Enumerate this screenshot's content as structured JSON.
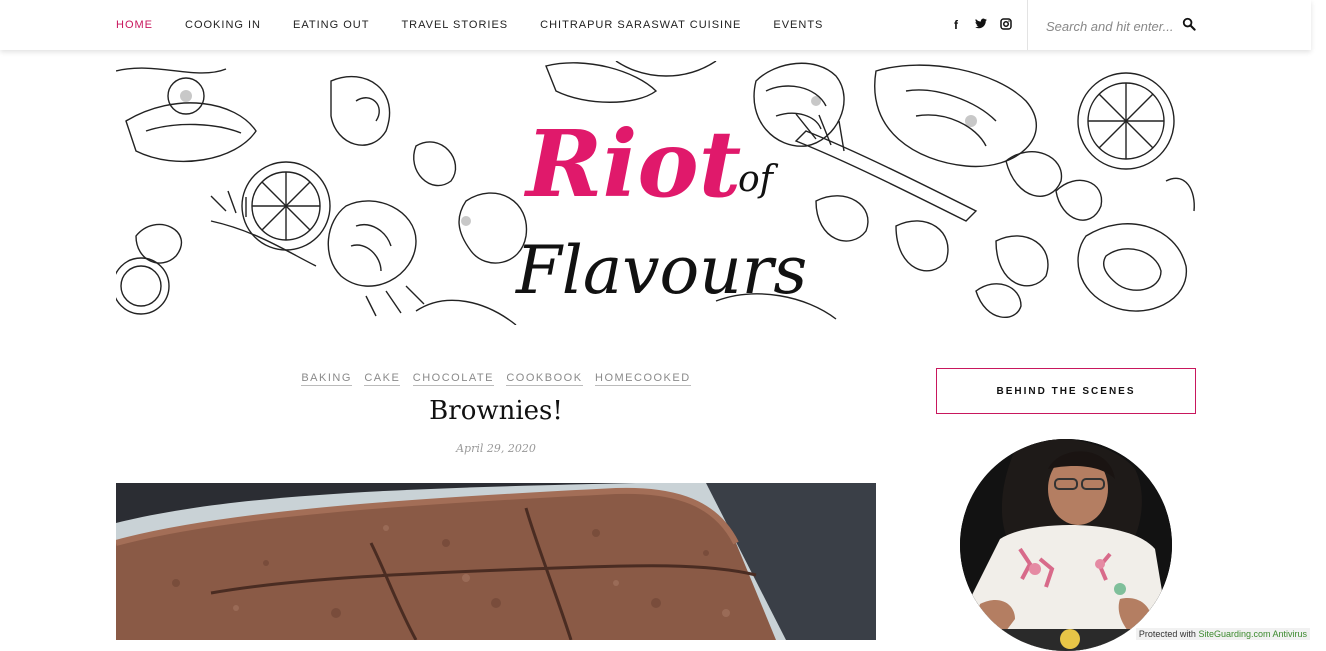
{
  "nav": {
    "items": [
      {
        "label": "HOME",
        "active": true
      },
      {
        "label": "COOKING IN",
        "active": false
      },
      {
        "label": "EATING OUT",
        "active": false
      },
      {
        "label": "TRAVEL STORIES",
        "active": false
      },
      {
        "label": "CHITRAPUR SARASWAT CUISINE",
        "active": false
      },
      {
        "label": "EVENTS",
        "active": false
      }
    ],
    "social": [
      {
        "name": "facebook-icon",
        "glyph": "f"
      },
      {
        "name": "twitter-icon",
        "glyph": "🐦"
      },
      {
        "name": "instagram-icon",
        "glyph": "◙"
      }
    ],
    "search_placeholder": "Search and hit enter..."
  },
  "header": {
    "logo_line1": "Riot",
    "logo_of": "of",
    "logo_line2": "Flavours"
  },
  "post": {
    "categories": [
      "BAKING",
      "CAKE",
      "CHOCOLATE",
      "COOKBOOK",
      "HOMECOOKED"
    ],
    "title": "Brownies!",
    "date": "April 29, 2020"
  },
  "sidebar": {
    "widget_title": "BEHIND THE SCENES"
  },
  "badge": {
    "prefix": "Protected with ",
    "link": "SiteGuarding.com Antivirus"
  },
  "colors": {
    "accent": "#c8175d",
    "text": "#222222",
    "muted": "#8a8a8a"
  }
}
